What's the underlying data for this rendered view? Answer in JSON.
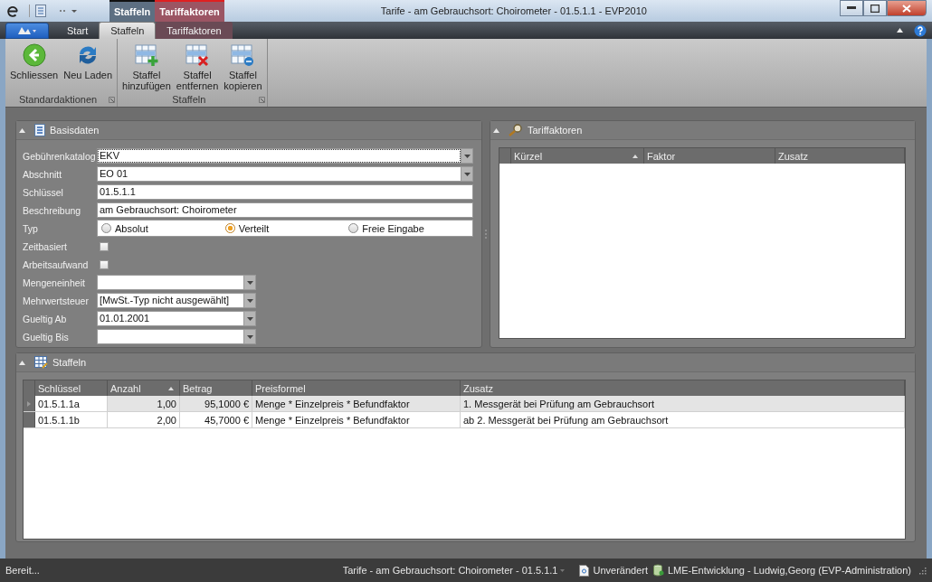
{
  "title_bar": {
    "title": "Tarife - am Gebrauchsort: Choirometer - 01.5.1.1 - EVP2010",
    "contextual_tabs": [
      {
        "label": "Staffeln",
        "color": "#5d6f82"
      },
      {
        "label": "Tariffaktoren",
        "color": "#9b5563"
      }
    ]
  },
  "ribbon_tabs": [
    {
      "label": "Start",
      "selected": false
    },
    {
      "label": "Staffeln",
      "selected": true
    },
    {
      "label": "Tariffaktoren",
      "selected": false,
      "color": "#6a4a55"
    }
  ],
  "ribbon_groups": [
    {
      "label": "Standardaktionen",
      "buttons": [
        {
          "label": "Schliessen",
          "kind": "back"
        },
        {
          "label": "Neu Laden",
          "kind": "reload"
        }
      ]
    },
    {
      "label": "Staffeln",
      "buttons": [
        {
          "label": "Staffel\nhinzufügen",
          "kind": "add"
        },
        {
          "label": "Staffel\nentfernen",
          "kind": "remove"
        },
        {
          "label": "Staffel\nkopieren",
          "kind": "copy"
        }
      ]
    }
  ],
  "basisdaten": {
    "title": "Basisdaten",
    "fields": [
      {
        "label": "Gebührenkatalog",
        "kind": "wide-dropdown",
        "value": "EKV"
      },
      {
        "label": "Abschnitt",
        "kind": "wide-dropdown",
        "value": "EO 01"
      },
      {
        "label": "Schlüssel",
        "kind": "text",
        "value": "01.5.1.1"
      },
      {
        "label": "Beschreibung",
        "kind": "text",
        "value": "am Gebrauchsort: Choirometer"
      },
      {
        "label": "Typ",
        "kind": "radio",
        "options": [
          {
            "label": "Absolut",
            "selected": false
          },
          {
            "label": "Verteilt",
            "selected": true
          },
          {
            "label": "Freie Eingabe",
            "selected": false
          }
        ]
      },
      {
        "label": "Zeitbasiert",
        "kind": "checkbox",
        "checked": false
      },
      {
        "label": "Arbeitsaufwand",
        "kind": "checkbox",
        "checked": false
      },
      {
        "label": "Mengeneinheit",
        "kind": "dropdown"
      },
      {
        "label": "Mehrwertsteuer",
        "kind": "dropdown",
        "value": "[MwSt.-Typ nicht ausgewählt]"
      },
      {
        "label": "Gueltig Ab",
        "kind": "dropdown",
        "value": "01.01.2001"
      },
      {
        "label": "Gueltig Bis",
        "kind": "dropdown"
      }
    ]
  },
  "tariffaktoren": {
    "title": "Tariffaktoren",
    "columns": [
      {
        "label": "Kürzel",
        "sorted": true
      },
      {
        "label": "Faktor",
        "sorted": false
      },
      {
        "label": "Zusatz",
        "sorted": false
      }
    ]
  },
  "staffeln": {
    "title": "Staffeln",
    "columns": [
      {
        "label": "Schlüssel",
        "sorted": false
      },
      {
        "label": "Anzahl",
        "sorted": true
      },
      {
        "label": "Betrag",
        "sorted": false
      },
      {
        "label": "Preisformel",
        "sorted": false
      },
      {
        "label": "Zusatz",
        "sorted": false
      }
    ],
    "rows": [
      {
        "selected": true,
        "cells": [
          "01.5.1.1a",
          "1,00",
          "95,1000 €",
          "Menge * Einzelpreis * Befundfaktor",
          "1. Messgerät bei Prüfung am Gebrauchsort"
        ]
      },
      {
        "selected": false,
        "cells": [
          "01.5.1.1b",
          "2,00",
          "45,7000 €",
          "Menge * Einzelpreis * Befundfaktor",
          "ab 2. Messgerät bei Prüfung am Gebrauchsort"
        ]
      }
    ]
  },
  "status_bar": {
    "left": "Bereit...",
    "document": "Tarife - am Gebrauchsort: Choirometer - 01.5.1.1",
    "state": "Unverändert",
    "connection": "LME-Entwicklung - Ludwig,Georg (EVP-Administration)"
  }
}
